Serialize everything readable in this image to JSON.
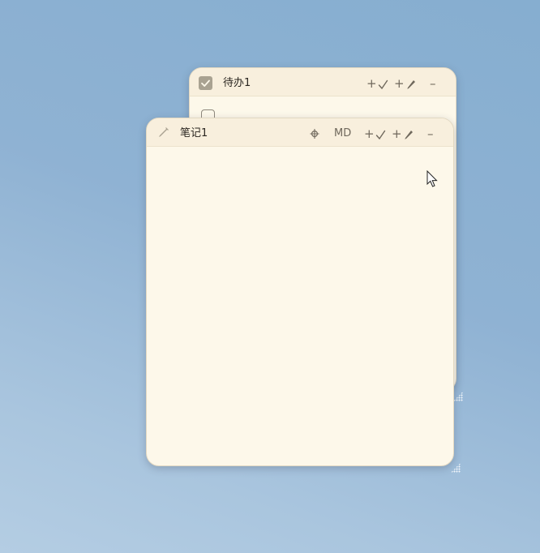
{
  "todo_window": {
    "title": "待办1",
    "add_todo_label": "+",
    "add_note_label": "+",
    "minimize_label": "–"
  },
  "note_window": {
    "title": "笔记1",
    "format_label": "MD",
    "add_todo_label": "+",
    "add_note_label": "+",
    "minimize_label": "–",
    "body_text": ""
  },
  "icons": {
    "checkbox": "checkbox-icon",
    "check": "check-icon",
    "pencil": "pencil-icon",
    "pin": "pin-icon",
    "cursor": "mouse-cursor-icon"
  },
  "colors": {
    "card_bg": "#fdf8ea",
    "titlebar_bg": "#f8efdd",
    "desktop_bg": "#8fb2d3"
  }
}
